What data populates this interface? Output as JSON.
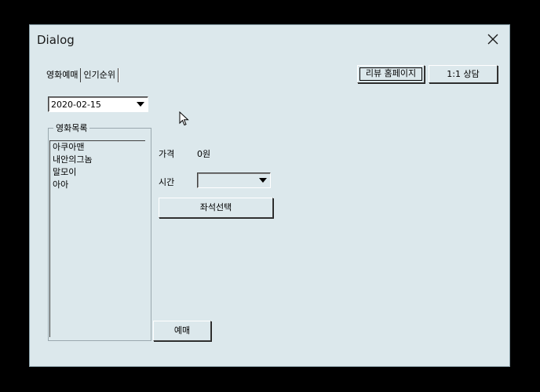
{
  "window": {
    "title": "Dialog"
  },
  "tabs": [
    {
      "label": "영화예매"
    },
    {
      "label": "인기순위"
    }
  ],
  "buttons": {
    "review": "리뷰 홈페이지",
    "counsel": "1:1 상담",
    "seat": "좌석선택",
    "book": "예매"
  },
  "date_picker": {
    "value": "2020-02-15"
  },
  "movie_group": {
    "label": "영화목록",
    "items": [
      {
        "label": "아쿠아맨"
      },
      {
        "label": "내안의그놈"
      },
      {
        "label": "말모이"
      },
      {
        "label": "아아"
      }
    ]
  },
  "price": {
    "label": "가격",
    "value": "0원"
  },
  "time": {
    "label": "시간",
    "value": ""
  }
}
